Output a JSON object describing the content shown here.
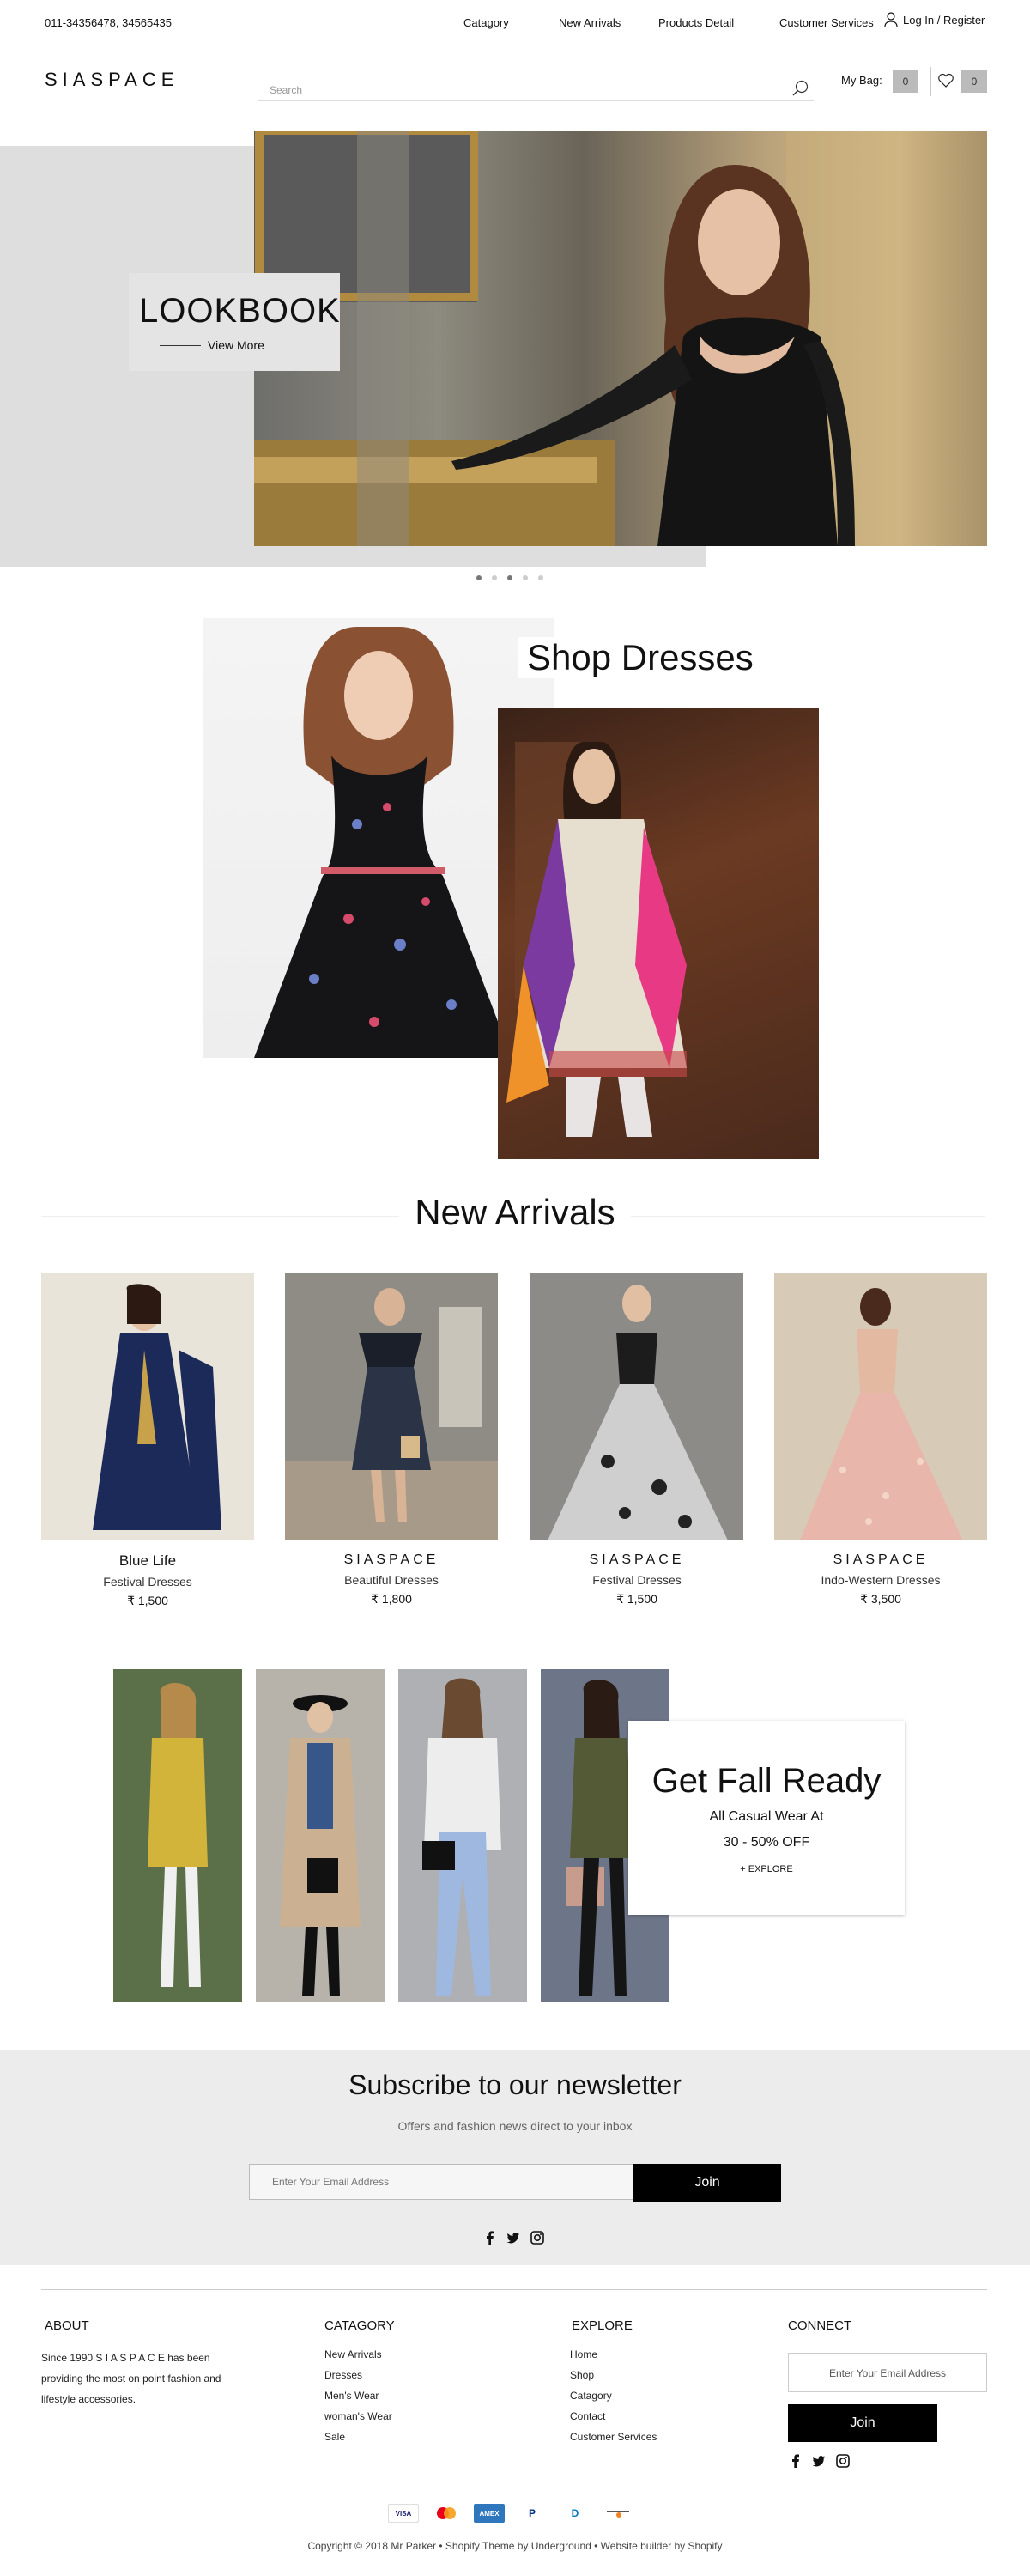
{
  "topbar": {
    "phone": "011-34356478, 34565435",
    "nav": [
      "Catagory",
      "New Arrivals",
      "Products Detail",
      "Customer Services"
    ],
    "login": "Log In / Register"
  },
  "header": {
    "logo": "SIASPACE",
    "search_placeholder": "Search",
    "bag_label": "My Bag:",
    "bag_count": "0",
    "wishlist_count": "0"
  },
  "hero": {
    "title": "LOOKBOOK",
    "link": "View More",
    "slides": 5,
    "active_slide": 3
  },
  "shop_dresses": {
    "title": "Shop Dresses"
  },
  "new_arrivals": {
    "title": "New Arrivals",
    "products": [
      {
        "name": "Blue Life",
        "category": "Festival Dresses",
        "price": "₹ 1,500",
        "brand": false
      },
      {
        "name": "SIASPACE",
        "category": "Beautiful Dresses",
        "price": "₹ 1,800",
        "brand": true
      },
      {
        "name": "SIASPACE",
        "category": "Festival Dresses",
        "price": "₹ 1,500",
        "brand": true
      },
      {
        "name": "SIASPACE",
        "category": "Indo-Western Dresses",
        "price": "₹ 3,500",
        "brand": true
      }
    ]
  },
  "fall": {
    "title": "Get Fall Ready",
    "line1": "All Casual Wear At",
    "line2": "30 - 50% OFF",
    "cta": "+ EXPLORE"
  },
  "newsletter": {
    "title": "Subscribe to our newsletter",
    "subtitle": "Offers and fashion news direct to your inbox",
    "placeholder": "Enter Your Email Address",
    "button": "Join"
  },
  "footer": {
    "about": {
      "heading": "ABOUT",
      "text": "Since 1990  S I A S P A C E has been providing the most on point fashion and lifestyle accessories."
    },
    "catagory": {
      "heading": "CATAGORY",
      "items": [
        "New Arrivals",
        "Dresses",
        "Men's Wear",
        "woman's Wear",
        "Sale"
      ]
    },
    "explore": {
      "heading": "EXPLORE",
      "items": [
        "Home",
        "Shop",
        "Catagory",
        "Contact",
        "Customer Services"
      ]
    },
    "connect": {
      "heading": "CONNECT",
      "placeholder": "Enter Your Email Address",
      "button": "Join"
    },
    "payments": [
      "VISA",
      "mastercard-icon",
      "AMEX",
      "P",
      "D",
      "discover-icon"
    ],
    "copyright": "Copyright © 2018 Mr Parker • Shopify Theme by Underground • Website builder by Shopify"
  }
}
